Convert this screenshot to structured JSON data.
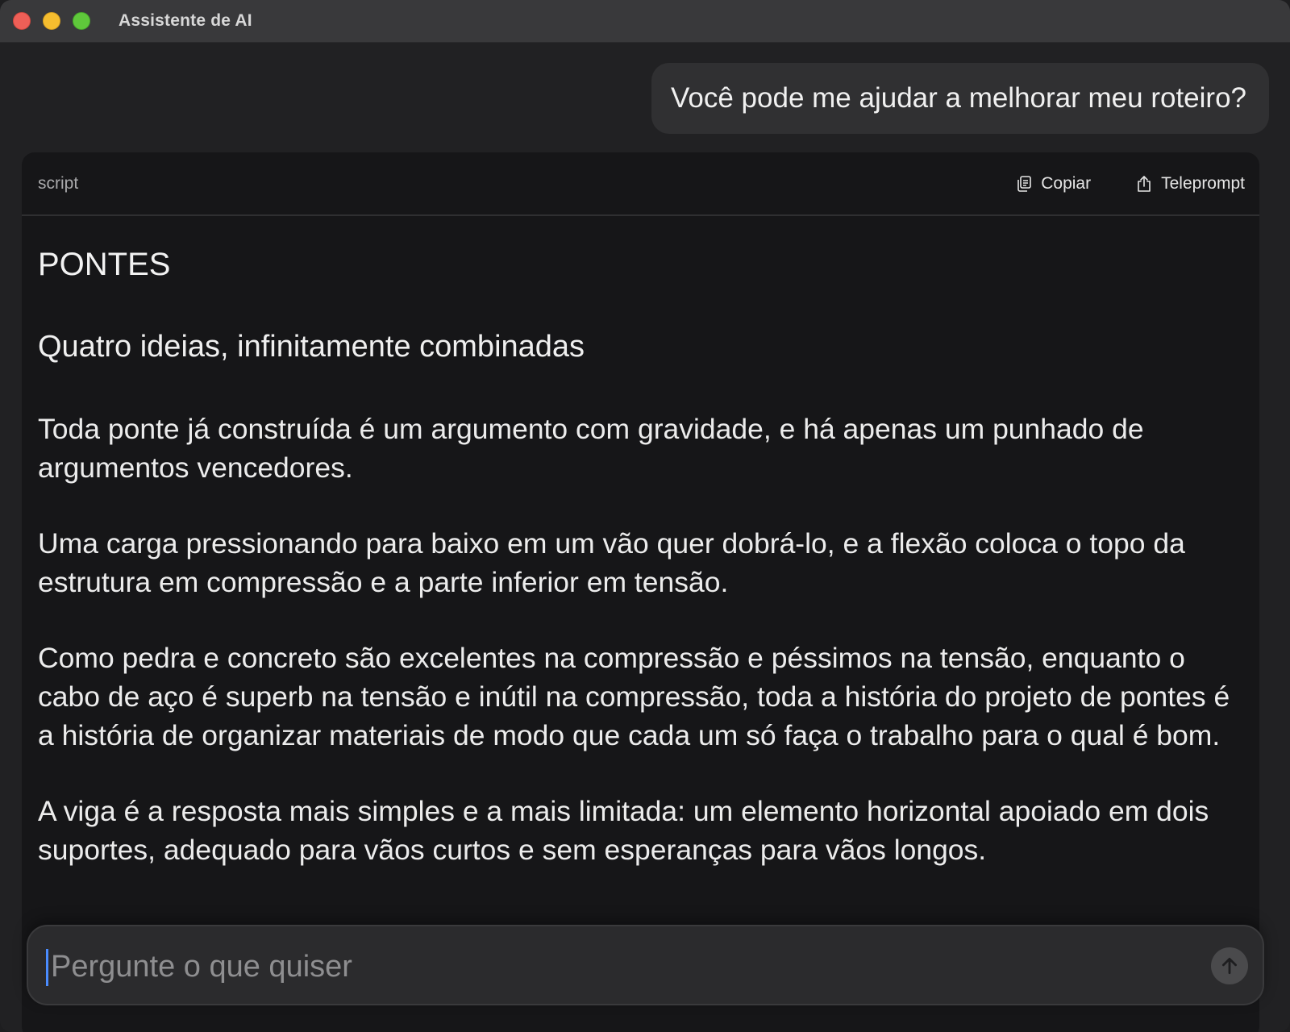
{
  "window": {
    "title": "Assistente de AI"
  },
  "conversation": {
    "user_message": "Você pode me ajudar a melhorar meu roteiro?"
  },
  "script_card": {
    "language_label": "script",
    "copy_label": "Copiar",
    "teleprompt_label": "Teleprompt",
    "title": "PONTES",
    "subtitle": "Quatro ideias, infinitamente combinadas",
    "paragraphs": [
      "Toda ponte já construída é um argumento com gravidade, e há apenas um punhado de argumentos vencedores.",
      "Uma carga pressionando para baixo em um vão quer dobrá-lo, e a flexão coloca o topo da estrutura em compressão e a parte inferior em tensão.",
      "Como pedra e concreto são excelentes na compressão e péssimos na tensão, enquanto o cabo de aço é superb na tensão e inútil na compressão, toda a história do projeto de pontes é a história de organizar materiais de modo que cada um só faça o trabalho para o qual é bom.",
      "A viga é a resposta mais simples e a mais limitada: um elemento horizontal apoiado em dois suportes, adequado para vãos curtos e sem esperanças para vãos longos."
    ]
  },
  "composer": {
    "placeholder": "Pergunte o que quiser",
    "value": ""
  },
  "icons": {
    "copy": "copy-icon",
    "teleprompt": "share-icon",
    "send": "arrow-up-icon"
  },
  "colors": {
    "close": "#ee5f57",
    "minimize": "#f5bd2f",
    "zoom": "#5fc83b",
    "caret": "#4a8cff"
  }
}
